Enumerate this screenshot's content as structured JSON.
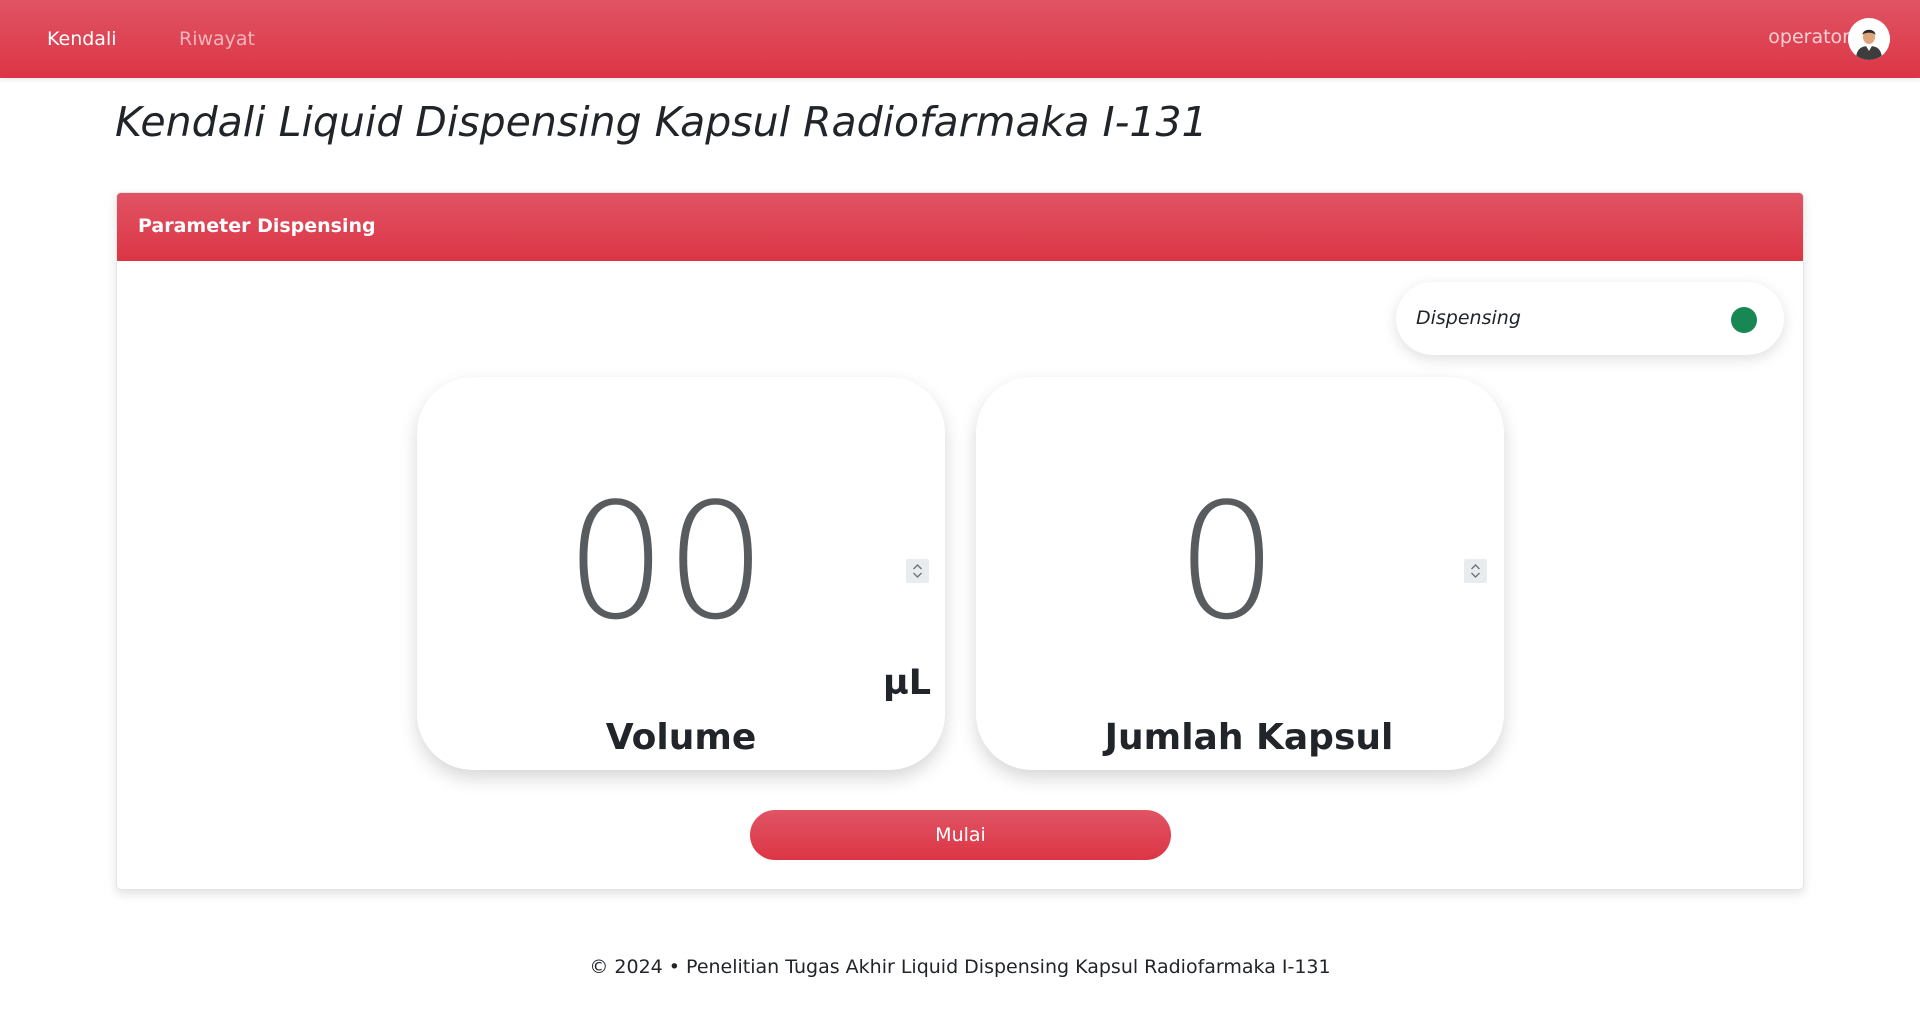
{
  "navbar": {
    "links": [
      {
        "label": "Kendali",
        "active": true
      },
      {
        "label": "Riwayat",
        "active": false
      }
    ],
    "user": {
      "name": "operator",
      "avatar_icon": "user-avatar-icon"
    }
  },
  "page": {
    "title": "Kendali Liquid Dispensing Kapsul Radiofarmaka I-131"
  },
  "card": {
    "header": "Parameter Dispensing",
    "status": {
      "label": "Dispensing",
      "indicator_color": "#198754"
    },
    "volume": {
      "value": "00",
      "unit": "µL",
      "label": "Volume"
    },
    "kapsul": {
      "value": "0",
      "label": "Jumlah Kapsul"
    },
    "start_button": "Mulai"
  },
  "footer": {
    "text": "© 2024 • Penelitian Tugas Akhir Liquid Dispensing Kapsul Radiofarmaka I-131"
  },
  "colors": {
    "primary": "#dc3545",
    "status_active": "#198754"
  }
}
